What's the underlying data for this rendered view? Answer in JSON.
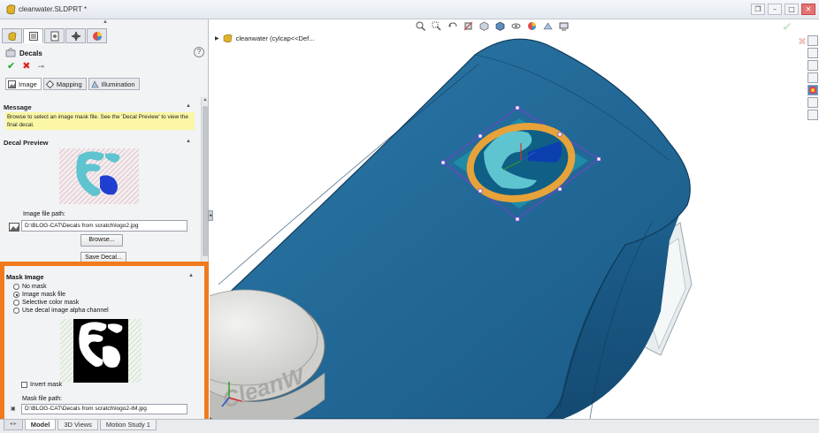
{
  "window": {
    "title": "cleanwater.SLDPRT *",
    "controls": [
      "restore-down",
      "minimize",
      "maximize",
      "close"
    ]
  },
  "feature_manager": {
    "tabs": [
      "feature-manager",
      "property-manager",
      "configuration-manager",
      "dimxpert-manager",
      "display-manager"
    ],
    "active_tab": 1
  },
  "property_manager": {
    "title": "Decals",
    "help": "?",
    "actions": {
      "ok": "✔",
      "cancel": "✖",
      "pin": "⊸"
    },
    "tabs": [
      {
        "label": "Image",
        "icon": "image-icon"
      },
      {
        "label": "Mapping",
        "icon": "mapping-icon"
      },
      {
        "label": "Illumination",
        "icon": "illumination-icon"
      }
    ],
    "message": {
      "header": "Message",
      "text": "Browse to select an image mask file. See the 'Decal Preview' to view the final decal."
    },
    "decal_preview": {
      "header": "Decal Preview",
      "path_label": "Image file path:",
      "path_value": "D:\\BLOG-CAT\\Decals from scratch\\logo2.jpg",
      "browse": "Browse...",
      "save": "Save Decal..."
    },
    "mask_image": {
      "header": "Mask Image",
      "options": [
        "No mask",
        "Image mask file",
        "Selective color mask",
        "Use decal image alpha channel"
      ],
      "selected": 1,
      "invert_label": "Invert mask",
      "invert_checked": false,
      "path_label": "Mask file path:",
      "path_value": "D:\\BLOG-CAT\\Decals from scratch\\logo2-IM.jpg"
    }
  },
  "bottom_tabs": [
    "Model",
    "3D Views",
    "Motion Study 1"
  ],
  "active_bottom_tab": 0,
  "graphics": {
    "tree_node": "cleanwater  (cylcap<<Def...",
    "colors": {
      "model_blue": "#1d5f8f",
      "orange_highlight": "#f07a1c",
      "decal_ring": "#e8a23a",
      "decal_dark": "#0b3fae"
    },
    "embossed_text": "CleanW"
  }
}
